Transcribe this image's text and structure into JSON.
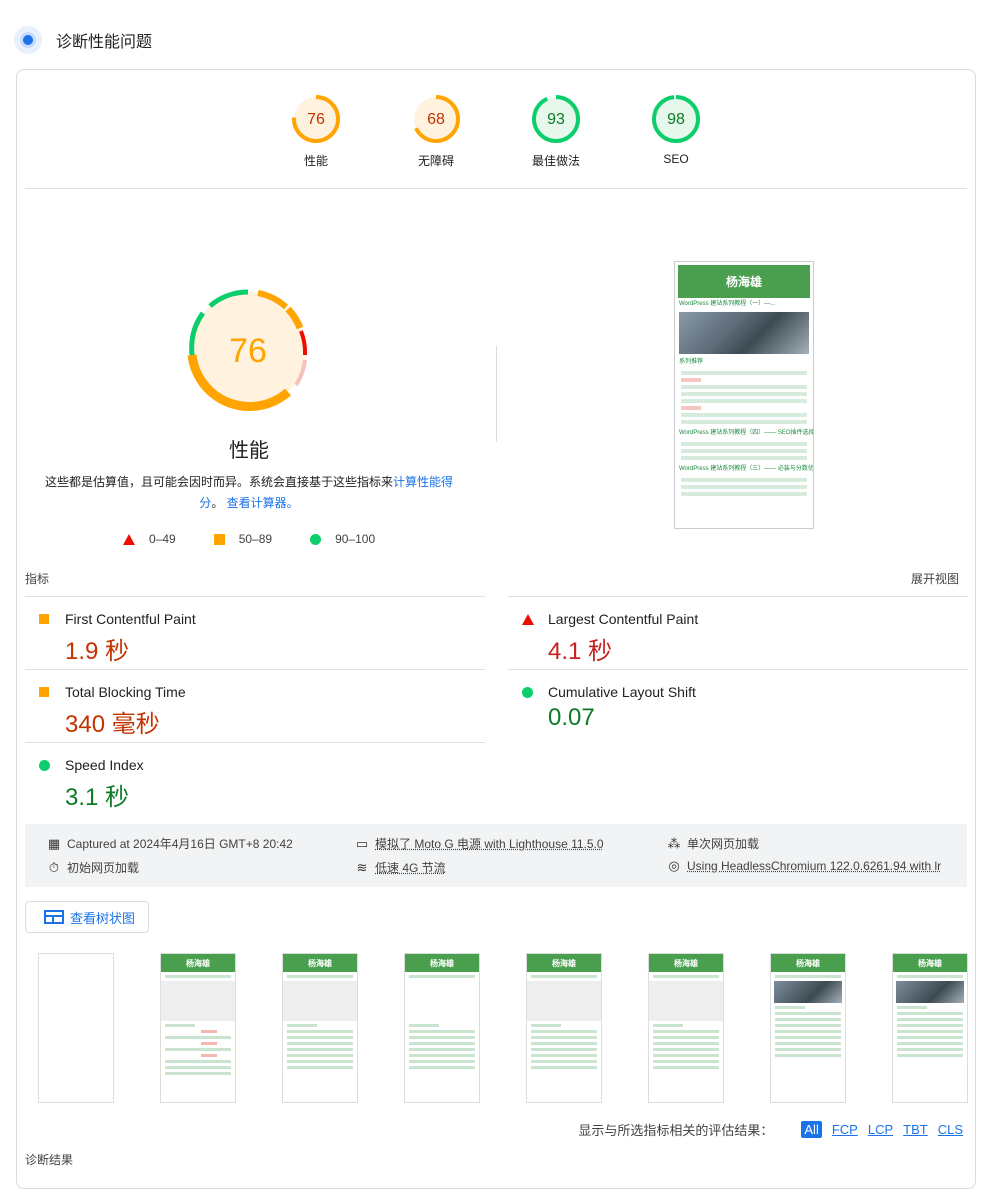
{
  "header": {
    "title": "诊断性能问题"
  },
  "categories": [
    {
      "label": "性能",
      "score": "76",
      "color": "#ffa400",
      "bg": "#fff3e0",
      "text": "#c33300"
    },
    {
      "label": "无障碍",
      "score": "68",
      "color": "#ffa400",
      "bg": "#fff3e0",
      "text": "#c33300"
    },
    {
      "label": "最佳做法",
      "score": "93",
      "color": "#0cce6b",
      "bg": "#e6f7ec",
      "text": "#0d7a26"
    },
    {
      "label": "SEO",
      "score": "98",
      "color": "#0cce6b",
      "bg": "#e6f7ec",
      "text": "#0d7a26"
    }
  ],
  "perf": {
    "score": "76",
    "title": "性能",
    "note_prefix": "这些都是估算值，且可能会因时而异。系统会直接基于这些指标来",
    "note_link1": "计算性能得分",
    "note_mid": "。 ",
    "note_link2": "查看计算器",
    "note_end": "。"
  },
  "legend": {
    "fail": "0–49",
    "average": "50–89",
    "pass": "90–100"
  },
  "screenshot": {
    "site_title": "杨海雄",
    "post1": "WordPress 建站系列教程（一）—...",
    "recommend": "系列推荐",
    "post2": "WordPress 建站系列教程（四）—— SEO插件选择",
    "post3": "WordPress 建站系列教程（三）—— 必装与分数优..."
  },
  "metrics_label": "指标",
  "expand_label": "展开视图",
  "metrics": [
    {
      "name": "First Contentful Paint",
      "value": "1.9 秒",
      "status": "average"
    },
    {
      "name": "Largest Contentful Paint",
      "value": "4.1 秒",
      "status": "fail"
    },
    {
      "name": "Total Blocking Time",
      "value": "340 毫秒",
      "status": "average"
    },
    {
      "name": "Cumulative Layout Shift",
      "value": "0.07",
      "status": "pass"
    },
    {
      "name": "Speed Index",
      "value": "3.1 秒",
      "status": "pass"
    }
  ],
  "runtime": {
    "captured": "Captured at 2024年4月16日 GMT+8 20:42",
    "emulated": "模拟了 Moto G 电源 with Lighthouse 11.5.0",
    "single_load": "单次网页加载",
    "initial_load": "初始网页加载",
    "throttling": "低速 4G 节流",
    "browser": "Using HeadlessChromium 122.0.6261.94 with lr"
  },
  "tree_button": "查看树状图",
  "filter": {
    "label": "显示与所选指标相关的评估结果：",
    "chips": [
      "All",
      "FCP",
      "LCP",
      "TBT",
      "CLS"
    ]
  },
  "diagnostics_label": "诊断结果"
}
